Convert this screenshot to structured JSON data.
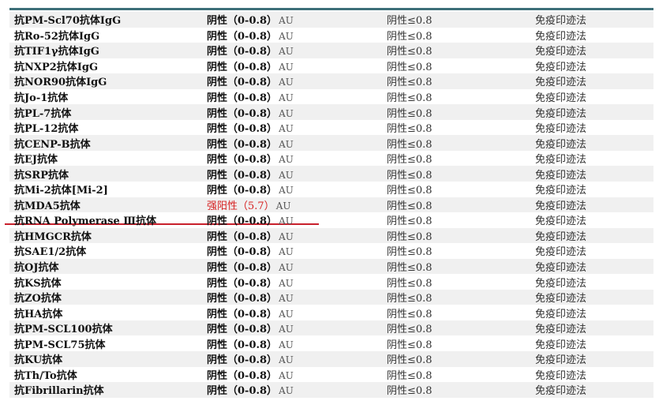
{
  "rows": [
    {
      "item": "抗PM-Scl70抗体IgG",
      "result": "阴性（0-0.8）",
      "unit": "AU",
      "ref": "阴性≤0.8",
      "method": "免疫印迹法"
    },
    {
      "item": "抗Ro-52抗体IgG",
      "result": "阴性（0-0.8）",
      "unit": "AU",
      "ref": "阴性≤0.8",
      "method": "免疫印迹法"
    },
    {
      "item": "抗TIF1γ抗体IgG",
      "result": "阴性（0-0.8）",
      "unit": "AU",
      "ref": "阴性≤0.8",
      "method": "免疫印迹法"
    },
    {
      "item": "抗NXP2抗体IgG",
      "result": "阴性（0-0.8）",
      "unit": "AU",
      "ref": "阴性≤0.8",
      "method": "免疫印迹法"
    },
    {
      "item": "抗NOR90抗体IgG",
      "result": "阴性（0-0.8）",
      "unit": "AU",
      "ref": "阴性≤0.8",
      "method": "免疫印迹法"
    },
    {
      "item": "抗Jo-1抗体",
      "result": "阴性（0-0.8）",
      "unit": "AU",
      "ref": "阴性≤0.8",
      "method": "免疫印迹法"
    },
    {
      "item": "抗PL-7抗体",
      "result": "阴性（0-0.8）",
      "unit": "AU",
      "ref": "阴性≤0.8",
      "method": "免疫印迹法"
    },
    {
      "item": "抗PL-12抗体",
      "result": "阴性（0-0.8）",
      "unit": "AU",
      "ref": "阴性≤0.8",
      "method": "免疫印迹法"
    },
    {
      "item": "抗CENP-B抗体",
      "result": "阴性（0-0.8）",
      "unit": "AU",
      "ref": "阴性≤0.8",
      "method": "免疫印迹法"
    },
    {
      "item": "抗EJ抗体",
      "result": "阴性（0-0.8）",
      "unit": "AU",
      "ref": "阴性≤0.8",
      "method": "免疫印迹法"
    },
    {
      "item": "抗SRP抗体",
      "result": "阴性（0-0.8）",
      "unit": "AU",
      "ref": "阴性≤0.8",
      "method": "免疫印迹法"
    },
    {
      "item": "抗Mi-2抗体[Mi-2]",
      "result": "阴性（0-0.8）",
      "unit": "AU",
      "ref": "阴性≤0.8",
      "method": "免疫印迹法"
    },
    {
      "item": "抗MDA5抗体",
      "result": "强阳性（5.7）",
      "unit": "AU",
      "ref": "阴性≤0.8",
      "method": "免疫印迹法",
      "positive": true
    },
    {
      "item": "抗RNA Polymerase Ⅲ抗体",
      "result": "阴性（0-0.8）",
      "unit": "AU",
      "ref": "阴性≤0.8",
      "method": "免疫印迹法"
    },
    {
      "item": "抗HMGCR抗体",
      "result": "阴性（0-0.8）",
      "unit": "AU",
      "ref": "阴性≤0.8",
      "method": "免疫印迹法"
    },
    {
      "item": "抗SAE1/2抗体",
      "result": "阴性（0-0.8）",
      "unit": "AU",
      "ref": "阴性≤0.8",
      "method": "免疫印迹法"
    },
    {
      "item": "抗OJ抗体",
      "result": "阴性（0-0.8）",
      "unit": "AU",
      "ref": "阴性≤0.8",
      "method": "免疫印迹法"
    },
    {
      "item": "抗KS抗体",
      "result": "阴性（0-0.8）",
      "unit": "AU",
      "ref": "阴性≤0.8",
      "method": "免疫印迹法"
    },
    {
      "item": "抗ZO抗体",
      "result": "阴性（0-0.8）",
      "unit": "AU",
      "ref": "阴性≤0.8",
      "method": "免疫印迹法"
    },
    {
      "item": "抗HA抗体",
      "result": "阴性（0-0.8）",
      "unit": "AU",
      "ref": "阴性≤0.8",
      "method": "免疫印迹法"
    },
    {
      "item": "抗PM-SCL100抗体",
      "result": "阴性（0-0.8）",
      "unit": "AU",
      "ref": "阴性≤0.8",
      "method": "免疫印迹法"
    },
    {
      "item": "抗PM-SCL75抗体",
      "result": "阴性（0-0.8）",
      "unit": "AU",
      "ref": "阴性≤0.8",
      "method": "免疫印迹法"
    },
    {
      "item": "抗KU抗体",
      "result": "阴性（0-0.8）",
      "unit": "AU",
      "ref": "阴性≤0.8",
      "method": "免疫印迹法"
    },
    {
      "item": "抗Th/To抗体",
      "result": "阴性（0-0.8）",
      "unit": "AU",
      "ref": "阴性≤0.8",
      "method": "免疫印迹法"
    },
    {
      "item": "抗Fibrillarin抗体",
      "result": "阴性（0-0.8）",
      "unit": "AU",
      "ref": "阴性≤0.8",
      "method": "免疫印迹法"
    }
  ],
  "colors": {
    "rule": "#3d6f78",
    "positive": "#d62020",
    "underline": "#c8202c",
    "stripe": "#f0f0f0"
  }
}
